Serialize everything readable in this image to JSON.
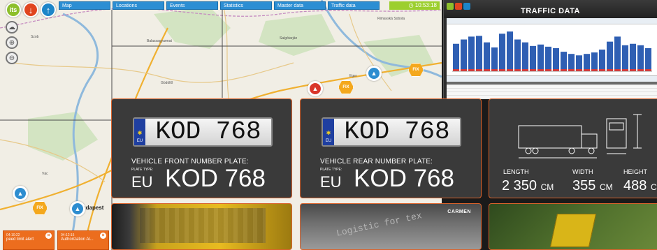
{
  "nav": {
    "its_label": "its",
    "tabs": [
      "Map",
      "Locations",
      "Events",
      "Statistics",
      "Master data",
      "Traffic data"
    ],
    "clock": "10:53:18"
  },
  "map": {
    "city": "Budapest",
    "markers": [
      {
        "kind": "car",
        "color": "blue"
      },
      {
        "kind": "car",
        "color": "red"
      },
      {
        "kind": "fix",
        "label": "FIX"
      },
      {
        "kind": "fix",
        "label": "FIX"
      },
      {
        "kind": "car",
        "color": "blue"
      },
      {
        "kind": "fix",
        "label": "FIX"
      },
      {
        "kind": "car",
        "color": "blue"
      }
    ]
  },
  "alerts": [
    {
      "time": "04:10:22",
      "text": "peed limit alert"
    },
    {
      "time": "04:12:15",
      "text": "Authorization Al..."
    }
  ],
  "traffic": {
    "title": "TRAFFIC DATA",
    "bar_values": [
      38,
      44,
      48,
      49,
      40,
      33,
      52,
      55,
      44,
      40,
      35,
      37,
      34,
      32,
      27,
      24,
      22,
      24,
      26,
      30,
      41,
      48,
      36,
      38,
      36,
      32
    ],
    "colors": {
      "bar": "#2f5fb3",
      "low": "#d13b3b"
    }
  },
  "front": {
    "plate": "KOD 768",
    "eu": "EU",
    "label": "VEHICLE FRONT NUMBER PLATE:",
    "type_label": "PLATE TYPE:",
    "country": "EU",
    "value": "KOD 768"
  },
  "rear": {
    "plate": "KOD 768",
    "eu": "EU",
    "label": "VEHICLE REAR NUMBER PLATE:",
    "type_label": "PLATE TYPE:",
    "country": "EU",
    "value": "KOD 768"
  },
  "dims": {
    "length_label": "LENGTH",
    "length_value": "2 350",
    "length_unit": "CM",
    "width_label": "WIDTH",
    "width_value": "355",
    "width_unit": "CM",
    "height_label": "HEIGHT",
    "height_value": "488",
    "height_unit": "C"
  },
  "photo": {
    "brand": "CARMEN",
    "watermark": "Logistic for tex"
  }
}
